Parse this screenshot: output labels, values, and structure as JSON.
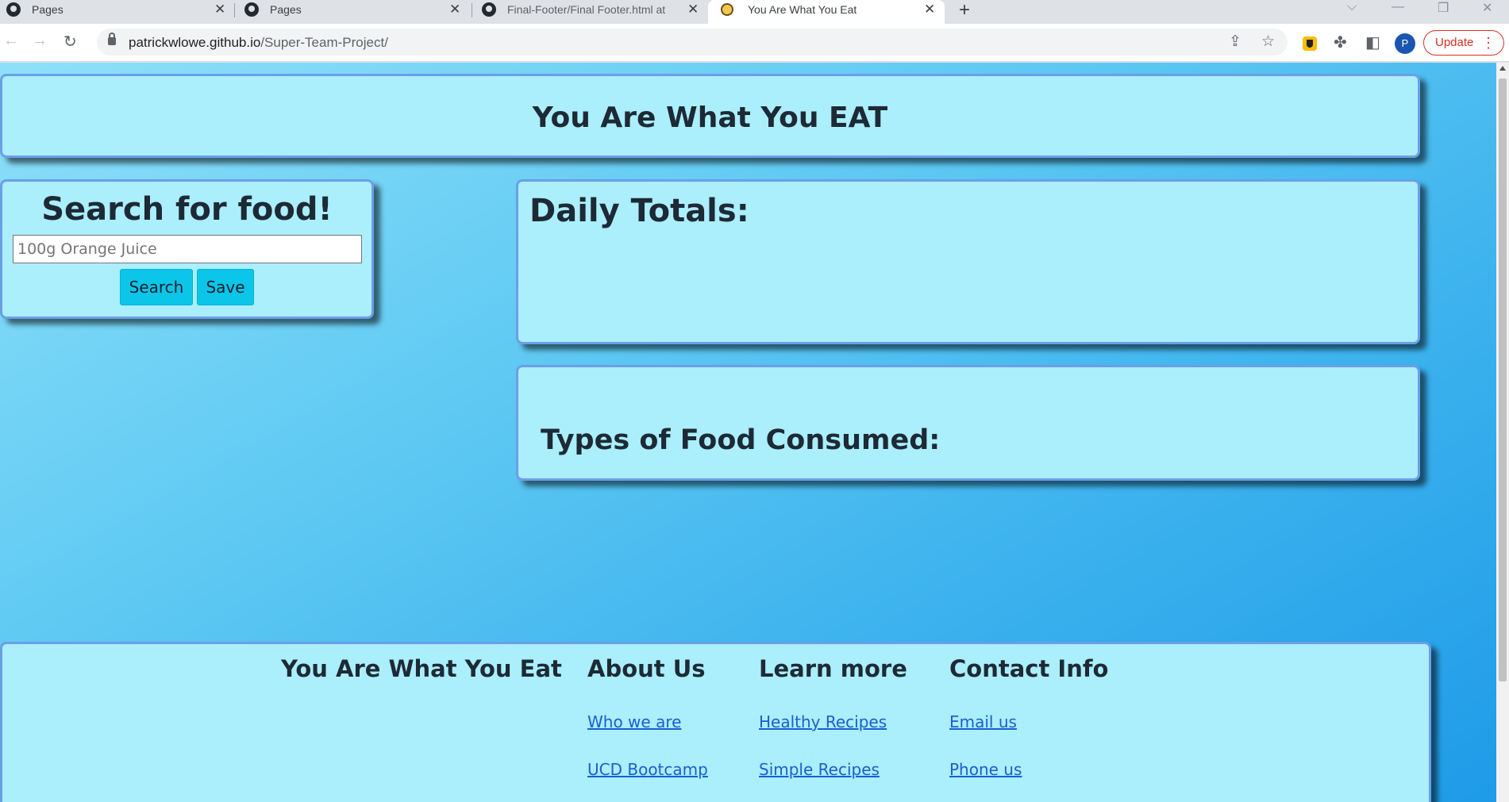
{
  "browser": {
    "tabs": [
      {
        "title": "Pages",
        "icon": "github-icon"
      },
      {
        "title": "Pages",
        "icon": "github-icon"
      },
      {
        "title": "Final-Footer/Final Footer.html at",
        "icon": "github-icon"
      },
      {
        "title": "You Are What You Eat",
        "icon": "fruit-favicon",
        "active": true
      }
    ],
    "url_host": "patrickwlowe.github.io",
    "url_path": "/Super-Team-Project/",
    "profile_initial": "P",
    "update_label": "Update"
  },
  "header": {
    "title": "You Are What You EAT"
  },
  "search": {
    "title": "Search for food!",
    "placeholder": "100g Orange Juice",
    "search_label": "Search",
    "save_label": "Save"
  },
  "totals": {
    "title": "Daily Totals:"
  },
  "types": {
    "title": "Types of Food Consumed:"
  },
  "footer": {
    "columns": [
      {
        "heading": "You Are What You Eat",
        "links": []
      },
      {
        "heading": "About Us",
        "links": [
          "Who we are",
          "UCD Bootcamp"
        ]
      },
      {
        "heading": "Learn more",
        "links": [
          "Healthy Recipes",
          "Simple Recipes"
        ]
      },
      {
        "heading": "Contact Info",
        "links": [
          "Email us",
          "Phone us"
        ]
      }
    ]
  },
  "colors": {
    "card_background": "#abeefc",
    "card_border": "#6b9fe8",
    "button": "#0bc6e8",
    "link": "#1a5fd0"
  }
}
